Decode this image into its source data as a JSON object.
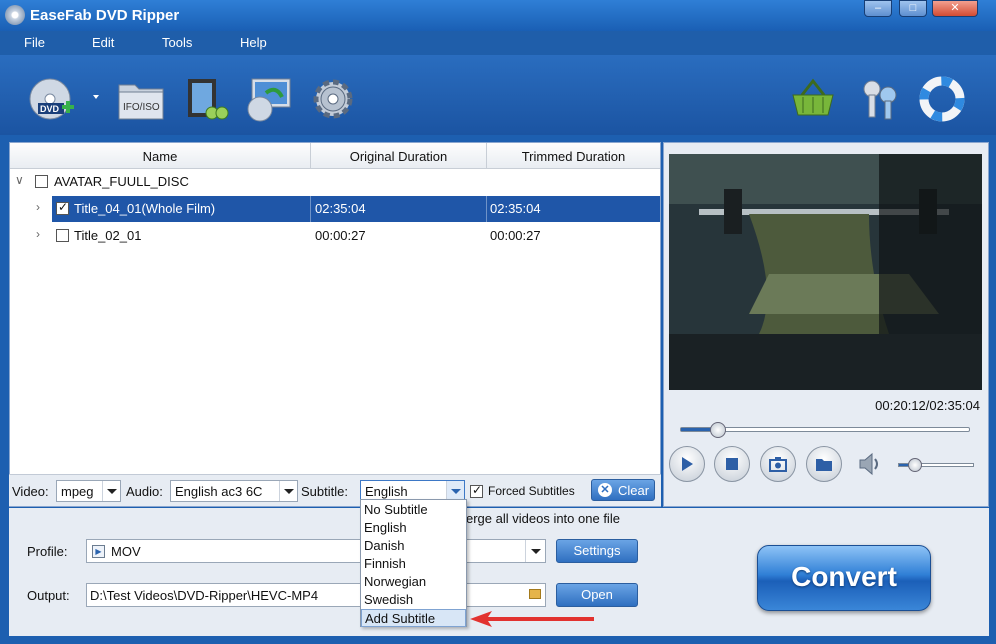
{
  "window": {
    "title": "EaseFab DVD Ripper",
    "min": "–",
    "max": "□",
    "close": "✕"
  },
  "menu": [
    "File",
    "Edit",
    "Tools",
    "Help"
  ],
  "toolbar": {
    "ifo_label": "IFO/ISO",
    "dvd_label": "DVD",
    "icons": [
      "load-dvd-icon",
      "load-ifo-iso-icon",
      "edit-video-icon",
      "copy-dvd-icon",
      "settings-gear-icon",
      "buy-basket-icon",
      "register-keys-icon",
      "help-lifebuoy-icon"
    ]
  },
  "list": {
    "columns": [
      "Name",
      "Original Duration",
      "Trimmed Duration"
    ],
    "disc": "AVATAR_FUULL_DISC",
    "rows": [
      {
        "name": "Title_04_01(Whole Film)",
        "original": "02:35:04",
        "trimmed": "02:35:04",
        "checked": true,
        "selected": true
      },
      {
        "name": "Title_02_01",
        "original": "00:00:27",
        "trimmed": "00:00:27",
        "checked": false,
        "selected": false
      }
    ]
  },
  "options": {
    "video_label": "Video:",
    "video_value": "mpeg",
    "audio_label": "Audio:",
    "audio_value": "English ac3 6C",
    "subtitle_label": "Subtitle:",
    "subtitle_value": "English",
    "forced_label": "Forced Subtitles",
    "forced_checked": true,
    "clear_label": "Clear"
  },
  "subtitle_menu": [
    "No Subtitle",
    "English",
    "Danish",
    "Finnish",
    "Norwegian",
    "Swedish",
    "Add Subtitle"
  ],
  "preview": {
    "timecode": "00:20:12/02:35:04",
    "progress": 0.13,
    "volume": 0.22
  },
  "bottom": {
    "merge_text": "erge all videos into one file",
    "profile_label": "Profile:",
    "profile_value": "MOV",
    "settings_label": "Settings",
    "output_label": "Output:",
    "output_value": "D:\\Test Videos\\DVD-Ripper\\HEVC-MP4",
    "open_label": "Open",
    "convert_label": "Convert"
  },
  "colors": {
    "accent": "#1f56a8",
    "annotation": "#e2322f"
  }
}
